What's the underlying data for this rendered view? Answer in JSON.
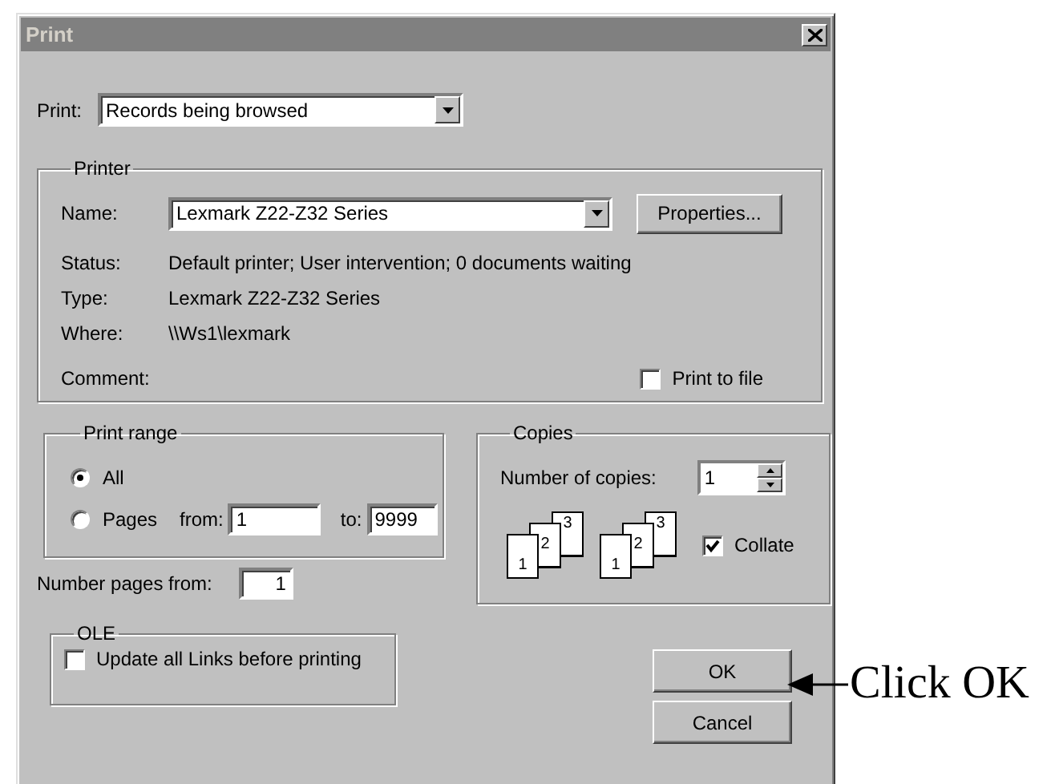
{
  "window": {
    "title": "Print"
  },
  "print_what": {
    "label": "Print:",
    "value": "Records being browsed"
  },
  "printer": {
    "title": "Printer",
    "name_label": "Name:",
    "name_value": "Lexmark Z22-Z32 Series",
    "properties_button": "Properties...",
    "info": [
      {
        "label": "Status:",
        "value": "Default printer; User intervention; 0 documents waiting"
      },
      {
        "label": "Type:",
        "value": "Lexmark Z22-Z32 Series"
      },
      {
        "label": "Where:",
        "value": "\\\\Ws1\\lexmark"
      },
      {
        "label": "Comment:"
      }
    ],
    "print_to_file": {
      "label": "Print to file",
      "checked": false
    }
  },
  "print_range": {
    "title": "Print range",
    "options": [
      {
        "label": "All",
        "selected": true
      },
      {
        "label": "Pages",
        "selected": false
      }
    ],
    "from_label": "from:",
    "from_value": "1",
    "to_label": "to:",
    "to_value": "9999"
  },
  "copies": {
    "title": "Copies",
    "number_label": "Number of copies:",
    "number_value": "1",
    "page_stacks": [
      [
        "1",
        "2",
        "3"
      ],
      [
        "1",
        "2",
        "3"
      ]
    ],
    "collate": {
      "label": "Collate",
      "checked": true
    }
  },
  "number_pages_from": {
    "label": "Number pages from:",
    "value": "1"
  },
  "ole": {
    "title": "OLE",
    "update_links": {
      "label": "Update all Links before printing",
      "checked": false
    }
  },
  "buttons": [
    "OK",
    "Cancel"
  ],
  "annotation": "Click OK"
}
